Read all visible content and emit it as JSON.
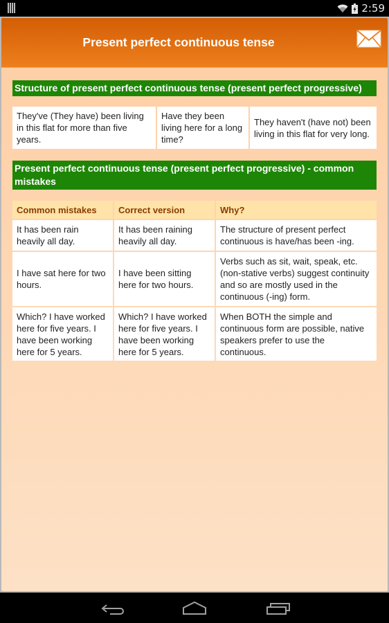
{
  "status_bar": {
    "time": "2:59",
    "icons": [
      "notification-bars-icon",
      "wifi-icon",
      "battery-charging-icon"
    ]
  },
  "header": {
    "title": "Present perfect continuous tense",
    "mail_icon": "mail-icon"
  },
  "section1": {
    "title": "Structure of present perfect continuous tense (present perfect progressive)",
    "examples": [
      "They've (They have) been living in this flat for more than five years.",
      "Have they been living here for a long time?",
      "They haven't (have not) been living in this flat for very long."
    ]
  },
  "section2": {
    "title": "Present perfect continuous tense (present perfect progressive) - common mistakes",
    "columns": [
      "Common mistakes",
      "Correct version",
      "Why?"
    ],
    "rows": [
      [
        "It has been rain heavily all day.",
        "It has been raining heavily all day.",
        "The structure of present perfect continuous is have/has been -ing."
      ],
      [
        "I have sat here for two hours.",
        "I have been sitting here for two hours.",
        "Verbs such as sit, wait, speak, etc. (non-stative verbs) suggest continuity and so are mostly used in the continuous (-ing) form."
      ],
      [
        "Which? I have worked here for five years. I have been working here for 5 years.",
        "Which? I have worked here for five years. I have been working here for 5 years.",
        "When BOTH the simple and continuous form are possible, native speakers prefer to use the continuous."
      ]
    ]
  },
  "nav_bar": {
    "buttons": [
      "back",
      "home",
      "recent-apps"
    ]
  },
  "colors": {
    "header_top": "#d35e05",
    "header_bottom": "#ee7f1d",
    "section_bar": "#1e8607",
    "table_header_bg": "#ffe3a8",
    "table_header_text": "#8a3c00",
    "page_bg_top": "#fecea4",
    "page_bg_bottom": "#fde1c6"
  }
}
